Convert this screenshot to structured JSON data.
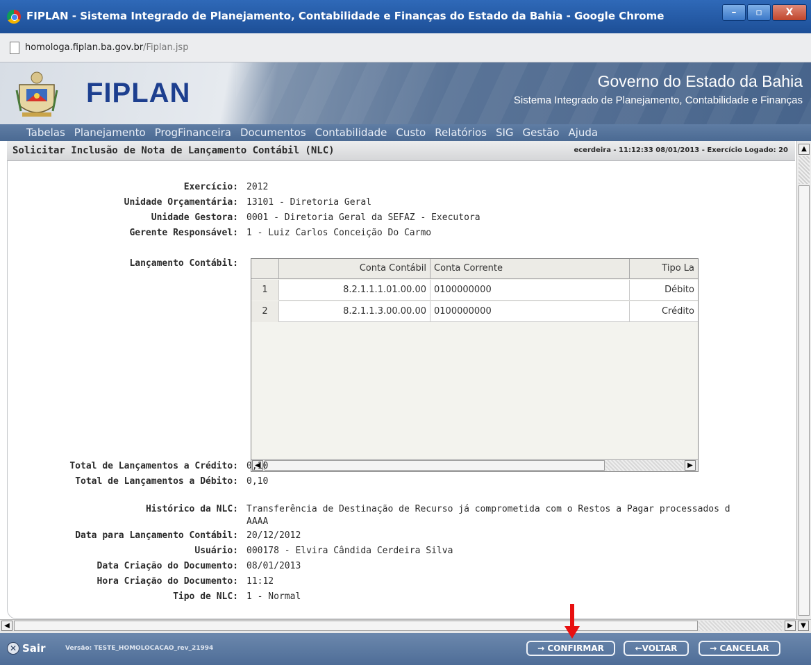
{
  "window": {
    "title": "FIPLAN - Sistema Integrado de Planejamento, Contabilidade e Finanças do Estado da Bahia - Google Chrome",
    "minimize": "–",
    "maximize": "▫",
    "close": "X"
  },
  "address": {
    "host": "homologa.fiplan.ba.gov.br",
    "path": "/Fiplan.jsp"
  },
  "banner": {
    "logo": "FIPLAN",
    "government": "Governo do Estado da Bahia",
    "system": "Sistema Integrado de Planejamento, Contabilidade e Finanças"
  },
  "menu": [
    "Tabelas",
    "Planejamento",
    "ProgFinanceira",
    "Documentos",
    "Contabilidade",
    "Custo",
    "Relatórios",
    "SIG",
    "Gestão",
    "Ajuda"
  ],
  "page": {
    "title": "Solicitar Inclusão de Nota de Lançamento Contábil (NLC)",
    "session": "ecerdeira - 11:12:33 08/01/2013 - Exercício Logado: 20"
  },
  "fields": {
    "exercicio": {
      "label": "Exercício:",
      "value": "2012"
    },
    "unidade_orcamentaria": {
      "label": "Unidade Orçamentária:",
      "value": "13101 - Diretoria Geral"
    },
    "unidade_gestora": {
      "label": "Unidade Gestora:",
      "value": "0001 - Diretoria Geral da SEFAZ - Executora"
    },
    "gerente": {
      "label": "Gerente Responsável:",
      "value": "1 - Luiz Carlos Conceição Do Carmo"
    },
    "lancamento_label": "Lançamento Contábil:",
    "total_credito": {
      "label": "Total de Lançamentos a Crédito:",
      "value": "0,10"
    },
    "total_debito": {
      "label": "Total de Lançamentos a Débito:",
      "value": "0,10"
    },
    "historico": {
      "label": "Histórico da NLC:",
      "value": "Transferência de Destinação de Recurso já comprometida com o Restos a Pagar processados d",
      "value2": "AAAA"
    },
    "data_lancamento": {
      "label": "Data para Lançamento Contábil:",
      "value": "20/12/2012"
    },
    "usuario": {
      "label": "Usuário:",
      "value": "000178 - Elvira Cândida Cerdeira Silva"
    },
    "data_criacao": {
      "label": "Data Criação do Documento:",
      "value": "08/01/2013"
    },
    "hora_criacao": {
      "label": "Hora Criação do Documento:",
      "value": "11:12"
    },
    "tipo_nlc": {
      "label": "Tipo de NLC:",
      "value": "1 - Normal"
    }
  },
  "grid": {
    "columns": [
      "Conta Contábil",
      "Conta Corrente",
      "Tipo La"
    ],
    "rows": [
      {
        "num": "1",
        "conta_contabil": "8.2.1.1.1.01.00.00",
        "conta_corrente": "0100000000",
        "tipo": "Débito"
      },
      {
        "num": "2",
        "conta_contabil": "8.2.1.1.3.00.00.00",
        "conta_corrente": "0100000000",
        "tipo": "Crédito"
      }
    ]
  },
  "footer": {
    "sair": "Sair",
    "versao": "Versão: TESTE_HOMOLOCACAO_rev_21994",
    "confirmar": "→ CONFIRMAR",
    "voltar": "←VOLTAR",
    "cancelar": "→ CANCELAR"
  },
  "colors": {
    "titlebar": "#2f69b8",
    "menubar": "#5f7da4",
    "footer": "#4e6d97",
    "annotation_arrow": "#e81010"
  }
}
